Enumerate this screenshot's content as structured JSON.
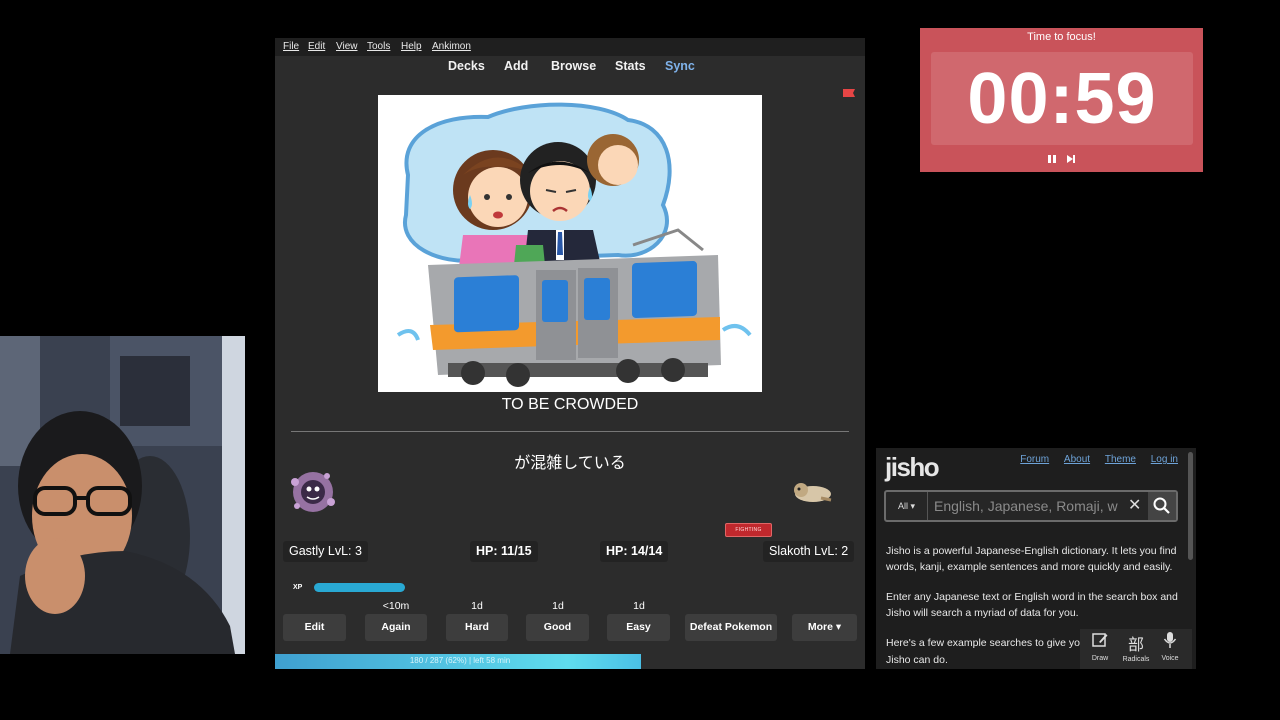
{
  "anki": {
    "menu": [
      "File",
      "Edit",
      "View",
      "Tools",
      "Help",
      "Ankimon"
    ],
    "toolbar": [
      "Decks",
      "Add",
      "Browse",
      "Stats",
      "Sync"
    ],
    "card": {
      "front": "TO BE CROWDED",
      "back": "が混雑している"
    },
    "battle": {
      "player_name": "Gastly LvL: 3",
      "player_hp": "HP: 11/15",
      "enemy_hp": "HP: 14/14",
      "enemy_name": "Slakoth LvL: 2",
      "enemy_type": "FIGHTING",
      "xp_label": "XP",
      "xp_fraction": 0.28
    },
    "intervals": [
      "<10m",
      "1d",
      "1d",
      "1d"
    ],
    "answer_buttons": [
      "Edit",
      "Again",
      "Hard",
      "Good",
      "Easy",
      "Defeat Pokemon",
      "More ▾"
    ],
    "progress": {
      "text": "180 / 287 (62%) | left 58 min",
      "fraction": 0.62
    },
    "colors": {
      "window": "#2c2c2c",
      "accent": "#7fb2ea",
      "flag": "#e64545"
    }
  },
  "timer": {
    "title": "Time to focus!",
    "value": "00:59",
    "controls": [
      "pause-icon",
      "skip-icon"
    ],
    "color": "#c9535a"
  },
  "jisho": {
    "logo": "jisho",
    "links": [
      "Forum",
      "About",
      "Theme",
      "Log in"
    ],
    "search": {
      "scope": "All",
      "placeholder": "English, Japanese, Romaji, w"
    },
    "paragraphs": [
      "Jisho is a powerful Japanese-English dictionary. It lets you find words, kanji, example sentences and more quickly and easily.",
      "Enter any Japanese text or English word in the search box and Jisho will search a myriad of data for you.",
      "Here's a few example searches to give yo",
      "Jisho can do."
    ],
    "tools": [
      {
        "label": "Draw",
        "icon": "draw-icon"
      },
      {
        "label": "Radicals",
        "icon": "部"
      },
      {
        "label": "Voice",
        "icon": "microphone-icon"
      }
    ]
  }
}
